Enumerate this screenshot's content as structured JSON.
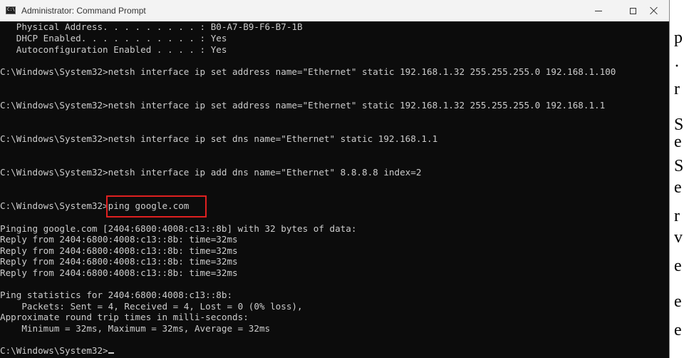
{
  "window": {
    "title": "Administrator: Command Prompt",
    "icon_text": "C:\\"
  },
  "console": {
    "lines": [
      "   Physical Address. . . . . . . . . : B0-A7-B9-F6-B7-1B",
      "   DHCP Enabled. . . . . . . . . . . : Yes",
      "   Autoconfiguration Enabled . . . . : Yes",
      "C:\\Windows\\System32>netsh interface ip set address name=\"Ethernet\" static 192.168.1.32 255.255.255.0 192.168.1.100",
      "C:\\Windows\\System32>netsh interface ip set address name=\"Ethernet\" static 192.168.1.32 255.255.255.0 192.168.1.1",
      "C:\\Windows\\System32>netsh interface ip set dns name=\"Ethernet\" static 192.168.1.1",
      "C:\\Windows\\System32>netsh interface ip add dns name=\"Ethernet\" 8.8.8.8 index=2",
      "C:\\Windows\\System32>ping google.com",
      "Pinging google.com [2404:6800:4008:c13::8b] with 32 bytes of data:",
      "Reply from 2404:6800:4008:c13::8b: time=32ms",
      "Reply from 2404:6800:4008:c13::8b: time=32ms",
      "Reply from 2404:6800:4008:c13::8b: time=32ms",
      "Reply from 2404:6800:4008:c13::8b: time=32ms",
      "Ping statistics for 2404:6800:4008:c13::8b:",
      "    Packets: Sent = 4, Received = 4, Lost = 0 (0% loss),",
      "Approximate round trip times in milli-seconds:",
      "    Minimum = 32ms, Maximum = 32ms, Average = 32ms",
      "C:\\Windows\\System32>"
    ]
  },
  "background_doc": {
    "chars": [
      "p",
      "·",
      "r",
      "S",
      "e",
      "S",
      "e",
      "r",
      "v",
      "e",
      "e",
      "e"
    ]
  },
  "colors": {
    "console_bg": "#0c0c0c",
    "console_fg": "#cccccc",
    "highlight": "#e02020",
    "titlebar_bg": "#f3f3f3"
  }
}
